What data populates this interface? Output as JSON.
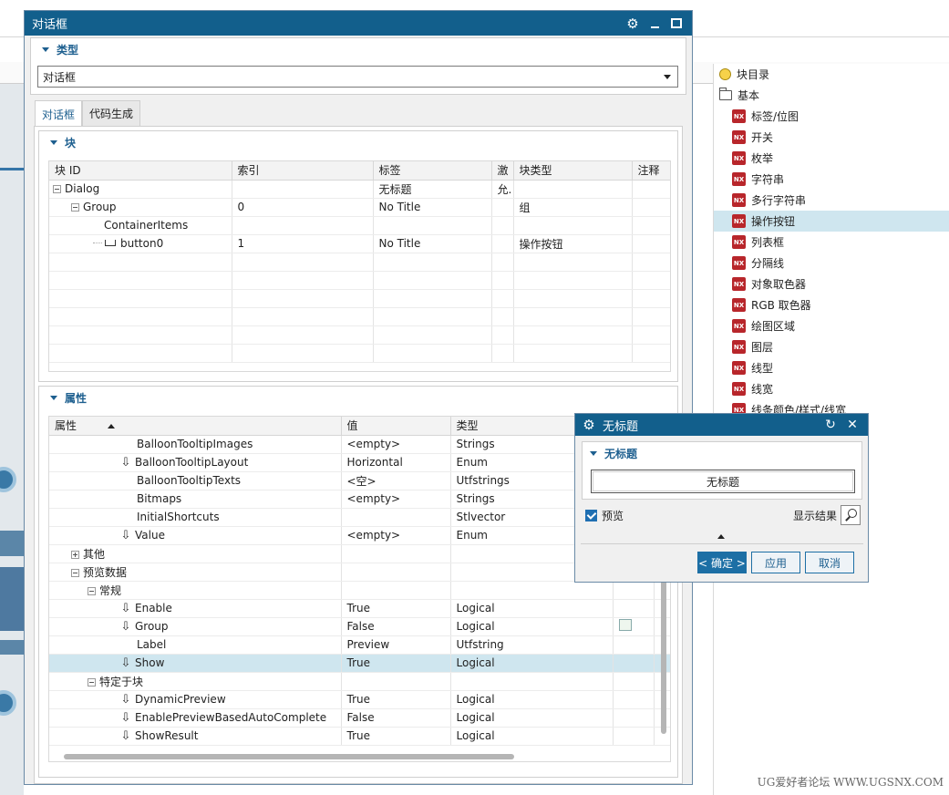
{
  "main_dialog": {
    "title": "对话框",
    "type_group": {
      "label": "类型",
      "selected": "对话框"
    },
    "tabs": [
      {
        "label": "对话框"
      },
      {
        "label": "代码生成"
      }
    ],
    "block_group": {
      "label": "块",
      "columns": [
        "块 ID",
        "索引",
        "标签",
        "激",
        "块类型",
        "注释"
      ],
      "rows": [
        {
          "id": "Dialog",
          "index": "",
          "label": "无标题",
          "active": "允.",
          "type": "",
          "note": ""
        },
        {
          "id": "Group",
          "index": "0",
          "label": "No Title",
          "active": "",
          "type": "组",
          "note": ""
        },
        {
          "id": "ContainerItems",
          "index": "",
          "label": "",
          "active": "",
          "type": "",
          "note": ""
        },
        {
          "id": "button0",
          "index": "1",
          "label": "No Title",
          "active": "",
          "type": "操作按钮",
          "note": ""
        }
      ]
    },
    "props_group": {
      "label": "属性",
      "columns": [
        "属性",
        "值",
        "类型"
      ],
      "rows": [
        {
          "name": "BalloonTooltipImages",
          "value": "<empty>",
          "type": "Strings"
        },
        {
          "name": "BalloonTooltipLayout",
          "value": "Horizontal",
          "type": "Enum"
        },
        {
          "name": "BalloonTooltipTexts",
          "value": "<空>",
          "type": "Utfstrings"
        },
        {
          "name": "Bitmaps",
          "value": "<empty>",
          "type": "Strings"
        },
        {
          "name": "InitialShortcuts",
          "value": "",
          "type": "Stlvector"
        },
        {
          "name": "Value",
          "value": "<empty>",
          "type": "Enum"
        },
        {
          "name": "其他",
          "value": "",
          "type": ""
        },
        {
          "name": "预览数据",
          "value": "",
          "type": ""
        },
        {
          "name": "常规",
          "value": "",
          "type": ""
        },
        {
          "name": "Enable",
          "value": "True",
          "type": "Logical"
        },
        {
          "name": "Group",
          "value": "False",
          "type": "Logical"
        },
        {
          "name": "Label",
          "value": "Preview",
          "type": "Utfstring"
        },
        {
          "name": "Show",
          "value": "True",
          "type": "Logical"
        },
        {
          "name": "特定于块",
          "value": "",
          "type": ""
        },
        {
          "name": "DynamicPreview",
          "value": "True",
          "type": "Logical"
        },
        {
          "name": "EnablePreviewBasedAutoComplete",
          "value": "False",
          "type": "Logical"
        },
        {
          "name": "ShowResult",
          "value": "True",
          "type": "Logical"
        }
      ]
    }
  },
  "preview_dialog": {
    "title": "无标题",
    "group_label": "无标题",
    "button_label": "无标题",
    "preview_label": "预览",
    "show_result_label": "显示结果",
    "ok_label": "< 确定 >",
    "apply_label": "应用",
    "cancel_label": "取消"
  },
  "catalog": {
    "title": "块目录",
    "folder": "基本",
    "items": [
      {
        "label": "标签/位图"
      },
      {
        "label": "开关"
      },
      {
        "label": "枚举"
      },
      {
        "label": "字符串"
      },
      {
        "label": "多行字符串"
      },
      {
        "label": "操作按钮"
      },
      {
        "label": "列表框"
      },
      {
        "label": "分隔线"
      },
      {
        "label": "对象取色器"
      },
      {
        "label": "RGB 取色器"
      },
      {
        "label": "绘图区域"
      },
      {
        "label": "图层"
      },
      {
        "label": "线型"
      },
      {
        "label": "线宽"
      },
      {
        "label": "线条颜色/样式/线宽"
      }
    ],
    "icon_text": "NX",
    "selected_index": 5
  },
  "watermark": "UG爱好者论坛 WWW.UGSNX.COM",
  "colors": {
    "titlebar": "#125f8c",
    "accent": "#1d5f8f",
    "selection": "#cfe6ef",
    "nx_icon": "#b8262b"
  }
}
